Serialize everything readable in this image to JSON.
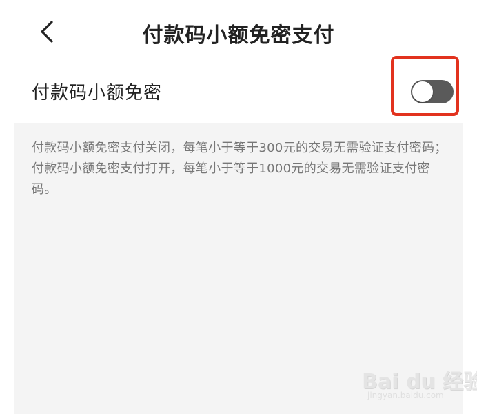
{
  "header": {
    "title": "付款码小额免密支付",
    "back_icon": "chevron-left-icon"
  },
  "setting": {
    "label": "付款码小额免密",
    "toggle_state": "off",
    "highlight_color": "#e2321e",
    "toggle_color": "#5a5a5a"
  },
  "info": {
    "description": "付款码小额免密支付关闭，每笔小于等于300元的交易无需验证支付密码；付款码小额免密支付打开，每笔小于等于1000元的交易无需验证支付密码。"
  },
  "watermark": {
    "brand": "Bai du 经验",
    "url": "jingyan.baidu.com"
  }
}
